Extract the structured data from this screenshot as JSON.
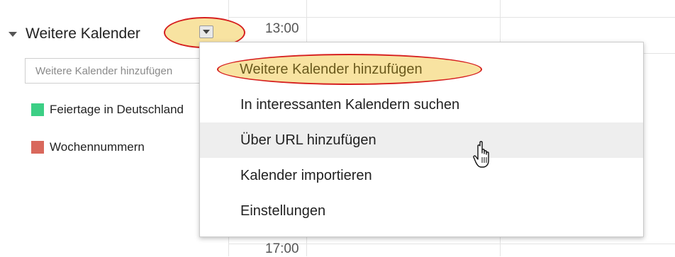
{
  "calendar": {
    "times": [
      "13:00",
      "17:00"
    ]
  },
  "sidebar": {
    "section_title": "Weitere Kalender",
    "add_placeholder": "Weitere Kalender hinzufügen",
    "calendars": [
      {
        "label": "Feiertage in Deutschland",
        "color": "#3ccf85"
      },
      {
        "label": "Wochennummern",
        "color": "#d9685c"
      }
    ]
  },
  "menu": {
    "items": [
      {
        "label": "Weitere Kalender hinzufügen"
      },
      {
        "label": "In interessanten Kalendern suchen"
      },
      {
        "label": "Über URL hinzufügen"
      },
      {
        "label": "Kalender importieren"
      },
      {
        "label": "Einstellungen"
      }
    ],
    "hovered_item": "Über URL hinzufügen"
  },
  "colors": {
    "annotation_red": "#d61f1f",
    "annotation_fill": "#f8e3a1",
    "hover_bg": "#eeeeee"
  }
}
